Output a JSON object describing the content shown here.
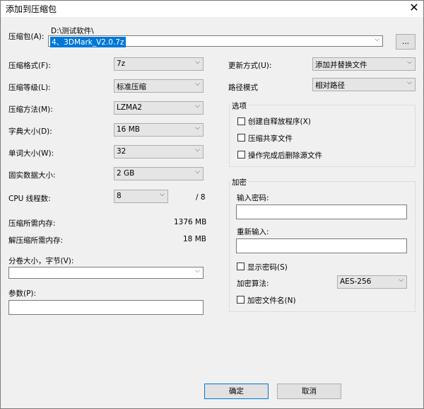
{
  "window": {
    "title": "添加到压缩包",
    "close_glyph": "✕"
  },
  "archive": {
    "label": "压缩包(A):",
    "folder": "D:\\测试软件\\",
    "filename": "4、3DMark_V2.0.7z",
    "browse_label": "..."
  },
  "left": {
    "format": {
      "label": "压缩格式(F):",
      "value": "7z"
    },
    "level": {
      "label": "压缩等级(L):",
      "value": "标准压缩"
    },
    "method": {
      "label": "压缩方法(M):",
      "value": "LZMA2"
    },
    "dict": {
      "label": "字典大小(D):",
      "value": "16 MB"
    },
    "word": {
      "label": "单词大小(W):",
      "value": "32"
    },
    "solid": {
      "label": "固实数据大小:",
      "value": "2 GB"
    },
    "threads": {
      "label": "CPU 线程数:",
      "value": "8",
      "total": "/ 8"
    },
    "mem_compress": {
      "label": "压缩所需内存:",
      "value": "1376 MB"
    },
    "mem_decompress": {
      "label": "解压缩所需内存:",
      "value": "18 MB"
    },
    "volume": {
      "label": "分卷大小，字节(V):",
      "value": ""
    },
    "params": {
      "label": "参数(P):",
      "value": ""
    }
  },
  "right": {
    "update": {
      "label": "更新方式(U):",
      "value": "添加并替换文件"
    },
    "path_mode": {
      "label": "路径模式",
      "value": "相对路径"
    },
    "options": {
      "title": "选项",
      "sfx": "创建自释放程序(X)",
      "shared": "压缩共享文件",
      "delete": "操作完成后删除源文件"
    },
    "encryption": {
      "title": "加密",
      "password_label": "输入密码:",
      "reenter_label": "重新输入:",
      "show_password": "显示密码(S)",
      "method_label": "加密算法:",
      "method_value": "AES-256",
      "encrypt_names": "加密文件名(N)"
    }
  },
  "buttons": {
    "ok": "确定",
    "cancel": "取消"
  },
  "icons": {
    "dropdown": "chevron-down-icon"
  }
}
